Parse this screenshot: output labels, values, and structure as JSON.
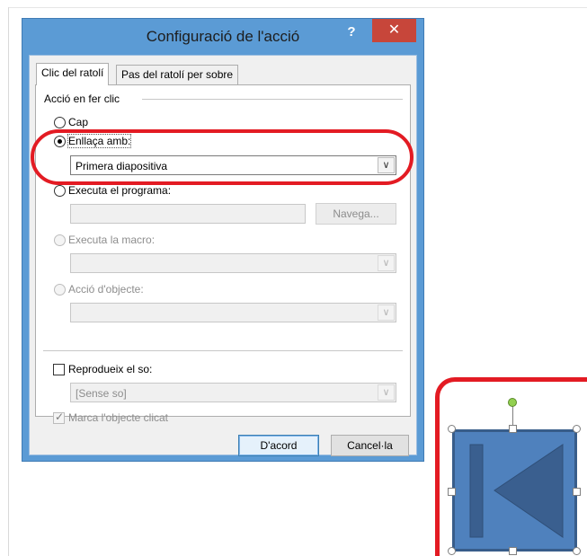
{
  "dialog": {
    "title": "Configuració de l'acció",
    "help_label": "?",
    "close_label": "✕",
    "tabs": [
      {
        "label": "Clic del ratolí",
        "active": true
      },
      {
        "label": "Pas del ratolí per sobre",
        "active": false
      }
    ],
    "group_label": "Acció en fer clic",
    "options": {
      "none_label": "Cap",
      "hyperlink_label": "Enllaça amb:",
      "hyperlink_value": "Primera diapositiva",
      "run_program_label": "Executa el programa:",
      "run_program_value": "",
      "browse_label": "Navega...",
      "run_macro_label": "Executa la macro:",
      "run_macro_value": "",
      "object_action_label": "Acció d'objecte:",
      "object_action_value": ""
    },
    "selected_option": "hyperlink",
    "sound": {
      "label": "Reprodueix el so:",
      "checked": false,
      "value": "[Sense so]"
    },
    "highlight_click": {
      "label": "Marca l'objecte clicat",
      "checked": true
    },
    "ok_label": "D'acord",
    "cancel_label": "Cancel·la"
  },
  "shape": {
    "type": "action-button-first",
    "fill_color": "#4f81bd",
    "border_color": "#385d8a",
    "icon_color": "#3a5f8f"
  },
  "annotation_color": "#e31b23"
}
